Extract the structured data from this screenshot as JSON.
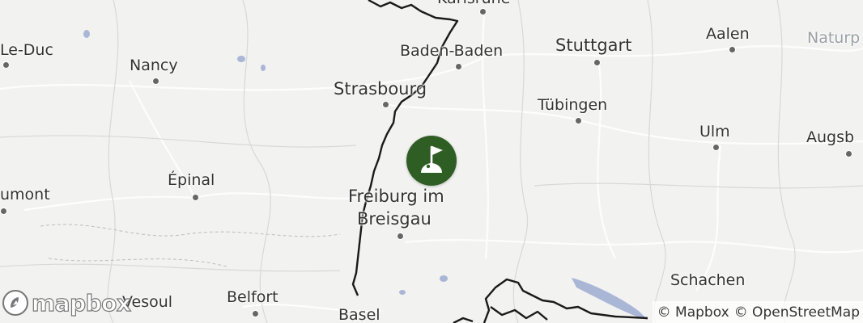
{
  "cities": [
    {
      "id": "karlsruhe",
      "name": "Karlsruhe",
      "size": "md"
    },
    {
      "id": "le-duc",
      "name": "Le-Duc",
      "size": "md"
    },
    {
      "id": "nancy",
      "name": "Nancy",
      "size": "md"
    },
    {
      "id": "baden-baden",
      "name": "Baden-Baden",
      "size": "md"
    },
    {
      "id": "stuttgart",
      "name": "Stuttgart",
      "size": "lg"
    },
    {
      "id": "aalen",
      "name": "Aalen",
      "size": "md"
    },
    {
      "id": "naturp",
      "name": "Naturp",
      "size": "md"
    },
    {
      "id": "strasbourg",
      "name": "Strasbourg",
      "size": "lg"
    },
    {
      "id": "tubingen",
      "name": "Tübingen",
      "size": "md"
    },
    {
      "id": "ulm",
      "name": "Ulm",
      "size": "md"
    },
    {
      "id": "augsburg",
      "name": "Augsb",
      "size": "md"
    },
    {
      "id": "epinal",
      "name": "Épinal",
      "size": "md"
    },
    {
      "id": "umont",
      "name": "umont",
      "size": "md"
    },
    {
      "id": "freiburg1",
      "name": "Freiburg im",
      "size": "lg"
    },
    {
      "id": "freiburg2",
      "name": "Breisgau",
      "size": "lg"
    },
    {
      "id": "schachen",
      "name": "Schachen",
      "size": "md"
    },
    {
      "id": "belfort",
      "name": "Belfort",
      "size": "md"
    },
    {
      "id": "vesoul",
      "name": "Vesoul",
      "size": "md"
    },
    {
      "id": "basel",
      "name": "Basel",
      "size": "md"
    }
  ],
  "marker": {
    "icon": "golf-flag-icon",
    "color": "#2f5e25"
  },
  "logo": {
    "text": "mapbox"
  },
  "attribution": {
    "mapbox": "© Mapbox",
    "osm": "© OpenStreetMap"
  }
}
